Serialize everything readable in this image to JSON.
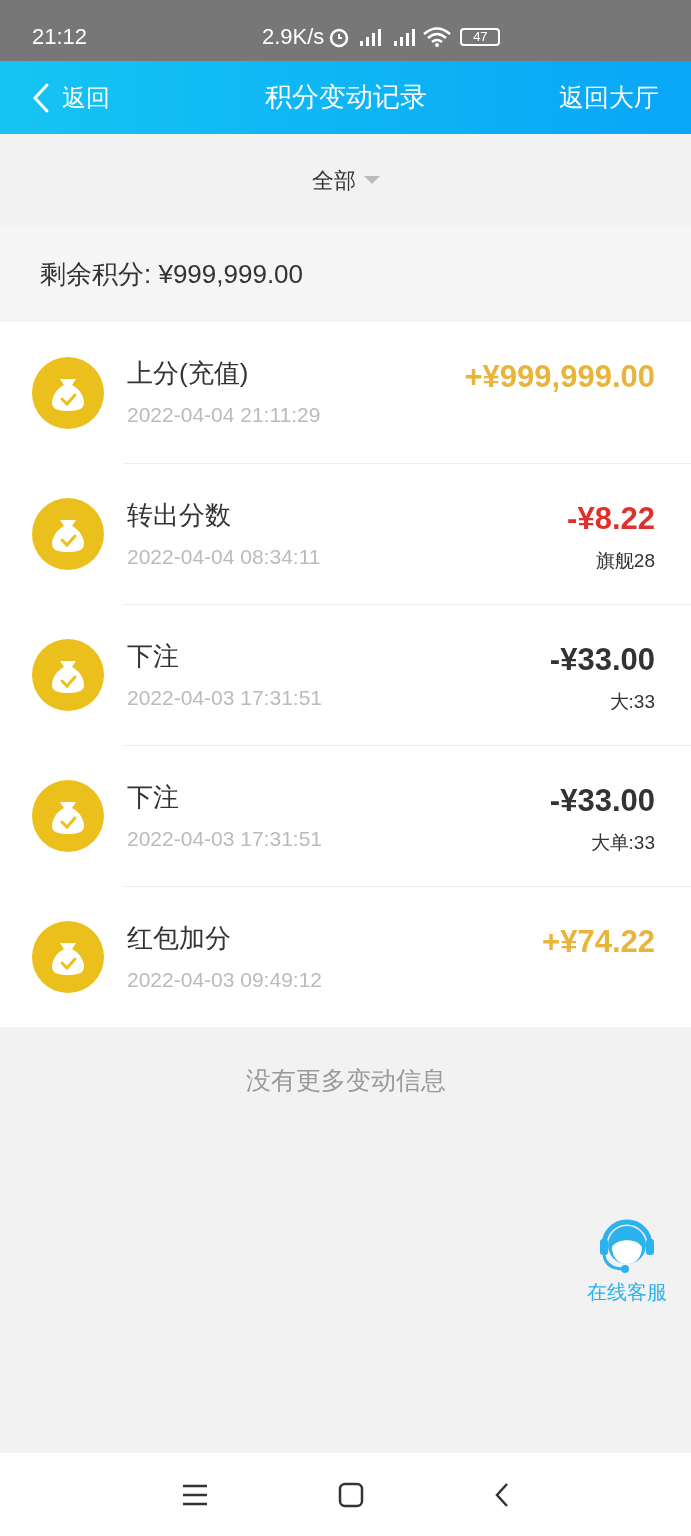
{
  "status_bar": {
    "time": "21:12",
    "speed": "2.9K/s",
    "battery": "47"
  },
  "header": {
    "back": "返回",
    "title": "积分变动记录",
    "lobby": "返回大厅"
  },
  "filter": {
    "label": "全部"
  },
  "balance": "剩余积分: ¥999,999.00",
  "records": [
    {
      "title": "上分(充值)",
      "time": "2022-04-04 21:11:29",
      "amount": "+¥999,999.00",
      "kind": "credit"
    },
    {
      "title": "转出分数",
      "time": "2022-04-04 08:34:11",
      "amount": "-¥8.22",
      "kind": "transfer",
      "note": "旗舰28"
    },
    {
      "title": "下注",
      "time": "2022-04-03 17:31:51",
      "amount": "-¥33.00",
      "kind": "debit",
      "note": "大:33"
    },
    {
      "title": "下注",
      "time": "2022-04-03 17:31:51",
      "amount": "-¥33.00",
      "kind": "debit",
      "note": "大单:33"
    },
    {
      "title": "红包加分",
      "time": "2022-04-03 09:49:12",
      "amount": "+¥74.22",
      "kind": "credit"
    }
  ],
  "end_message": "没有更多变动信息",
  "support": {
    "label": "在线客服"
  }
}
